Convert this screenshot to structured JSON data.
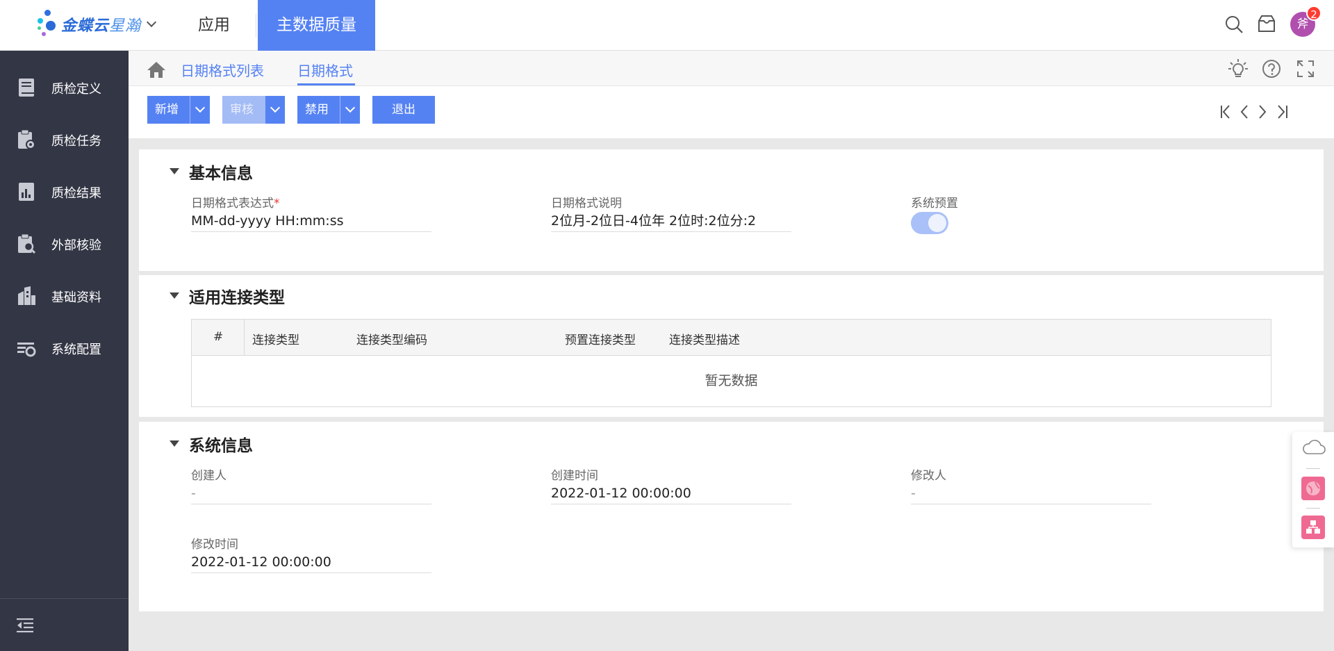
{
  "header": {
    "logo_text": "金蝶云",
    "logo_sub": "星瀚",
    "nav_apps": "应用",
    "nav_active": "主数据质量",
    "avatar_text": "斧",
    "notification_count": "2"
  },
  "sidebar": {
    "items": [
      {
        "label": "质检定义",
        "icon": "book-icon"
      },
      {
        "label": "质检任务",
        "icon": "task-clipboard-icon"
      },
      {
        "label": "质检结果",
        "icon": "report-icon"
      },
      {
        "label": "外部核验",
        "icon": "clipboard-search-icon"
      },
      {
        "label": "基础资料",
        "icon": "building-icon"
      },
      {
        "label": "系统配置",
        "icon": "settings-list-icon"
      }
    ]
  },
  "breadcrumb": {
    "items": [
      "日期格式列表",
      "日期格式"
    ]
  },
  "toolbar": {
    "add_label": "新增",
    "audit_label": "审核",
    "disable_label": "禁用",
    "exit_label": "退出"
  },
  "basic_info": {
    "title": "基本信息",
    "expr_label": "日期格式表达式",
    "expr_required": "*",
    "expr_value": "MM-dd-yyyy HH:mm:ss",
    "desc_label": "日期格式说明",
    "desc_value": "2位月-2位日-4位年 2位时:2位分:2",
    "preset_label": "系统预置",
    "preset_on": true
  },
  "conn_types": {
    "title": "适用连接类型",
    "columns": [
      "#",
      "连接类型",
      "连接类型编码",
      "预置连接类型",
      "连接类型描述"
    ],
    "empty_text": "暂无数据"
  },
  "sys_info": {
    "title": "系统信息",
    "creator_label": "创建人",
    "creator_value": "-",
    "created_label": "创建时间",
    "created_value": "2022-01-12 00:00:00",
    "modifier_label": "修改人",
    "modifier_value": "-",
    "modified_label": "修改时间",
    "modified_value": "2022-01-12 00:00:00"
  },
  "colors": {
    "primary": "#5582f3",
    "sidebar_bg": "#333645",
    "badge": "#ff3b30",
    "avatar": "#b04fae"
  }
}
